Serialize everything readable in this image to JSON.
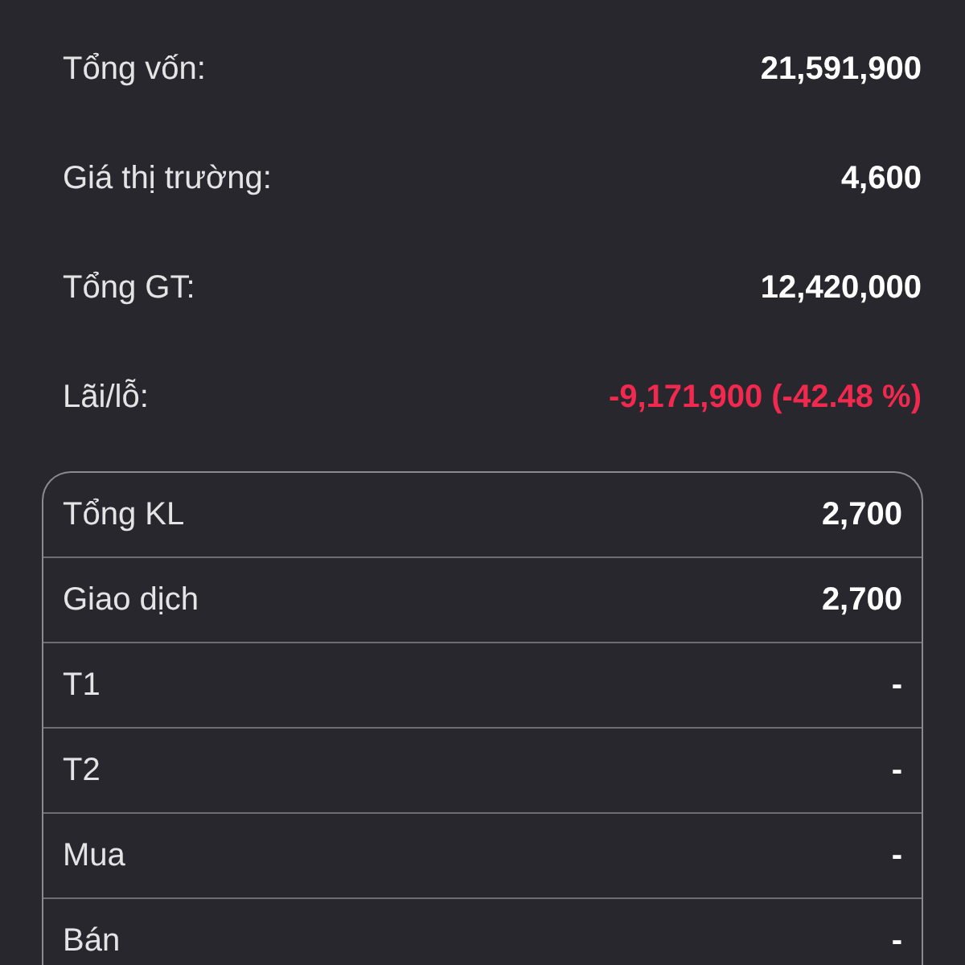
{
  "summary": [
    {
      "label": "Tổng vốn:",
      "value": "21,591,900",
      "kind": "plain"
    },
    {
      "label": "Giá thị trường:",
      "value": "4,600",
      "kind": "plain"
    },
    {
      "label": "Tổng GT:",
      "value": "12,420,000",
      "kind": "plain"
    },
    {
      "label": "Lãi/lỗ:",
      "value": "-9,171,900 (-42.48 %)",
      "kind": "loss"
    }
  ],
  "volume_table": {
    "rows": [
      {
        "label": "Tổng KL",
        "value": "2,700"
      },
      {
        "label": "Giao dịch",
        "value": "2,700"
      },
      {
        "label": "T1",
        "value": "-"
      },
      {
        "label": "T2",
        "value": "-"
      },
      {
        "label": "Mua",
        "value": "-"
      },
      {
        "label": "Bán",
        "value": "-"
      }
    ]
  }
}
